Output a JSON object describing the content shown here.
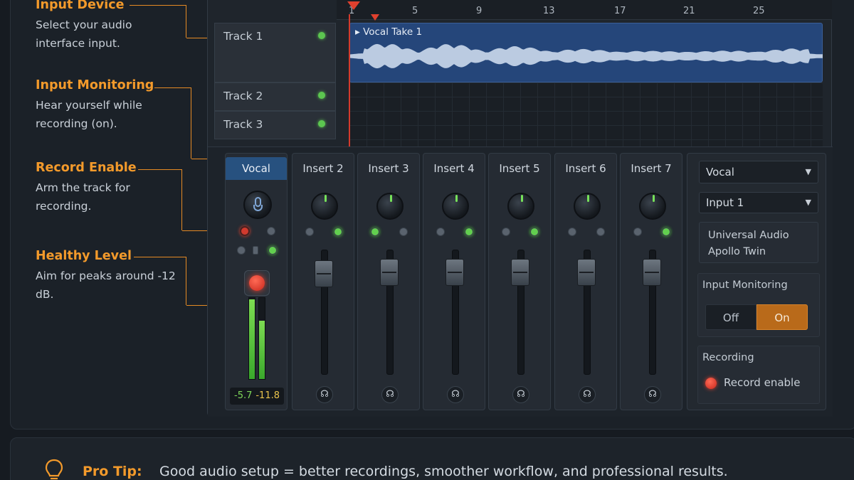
{
  "annotations": [
    {
      "title": "Input Device",
      "desc": "Select your audio interface input."
    },
    {
      "title": "Input Monitoring",
      "desc": "Hear yourself while recording (on)."
    },
    {
      "title": "Record Enable",
      "desc": "Arm the track for recording."
    },
    {
      "title": "Healthy Level",
      "desc": "Aim for peaks around -12 dB."
    }
  ],
  "ruler": {
    "marks": [
      "1",
      "5",
      "9",
      "13",
      "17",
      "21",
      "25"
    ]
  },
  "tracks": [
    {
      "label": "Track 1",
      "led": "green"
    },
    {
      "label": "Track 2",
      "led": "green"
    },
    {
      "label": "Track 3",
      "led": "green"
    }
  ],
  "clip": {
    "label": "▸ Vocal Take 1"
  },
  "mixer": {
    "vocal": {
      "name": "Vocal",
      "meter_left_level": 0.98,
      "meter_right_level": 0.72,
      "readout_left": "-5.7",
      "readout_right": "-11.8"
    },
    "inserts": [
      {
        "name": "Insert 2",
        "dots": [
          "gray",
          "green"
        ]
      },
      {
        "name": "Insert 3",
        "dots": [
          "green",
          "gray"
        ]
      },
      {
        "name": "Insert 4",
        "dots": [
          "gray",
          "green"
        ]
      },
      {
        "name": "Insert 5",
        "dots": [
          "gray",
          "green"
        ]
      },
      {
        "name": "Insert 6",
        "dots": [
          "gray",
          "gray"
        ]
      },
      {
        "name": "Insert 7",
        "dots": [
          "gray",
          "green"
        ]
      }
    ]
  },
  "right_panel": {
    "track_select": "Vocal",
    "input_select": "Input 1",
    "device_line1": "Universal Audio",
    "device_line2": "Apollo Twin",
    "monitoring_title": "Input Monitoring",
    "monitoring_off": "Off",
    "monitoring_on": "On",
    "recording_title": "Recording",
    "record_enable_label": "Record enable"
  },
  "tip": {
    "label": "Pro Tip:",
    "text": "Good audio setup = better recordings, smoother workflow, and professional results."
  },
  "colors": {
    "accent": "#f39a2b",
    "clip": "#25467a",
    "record": "#e0402e",
    "meter": "#62cf4f"
  }
}
